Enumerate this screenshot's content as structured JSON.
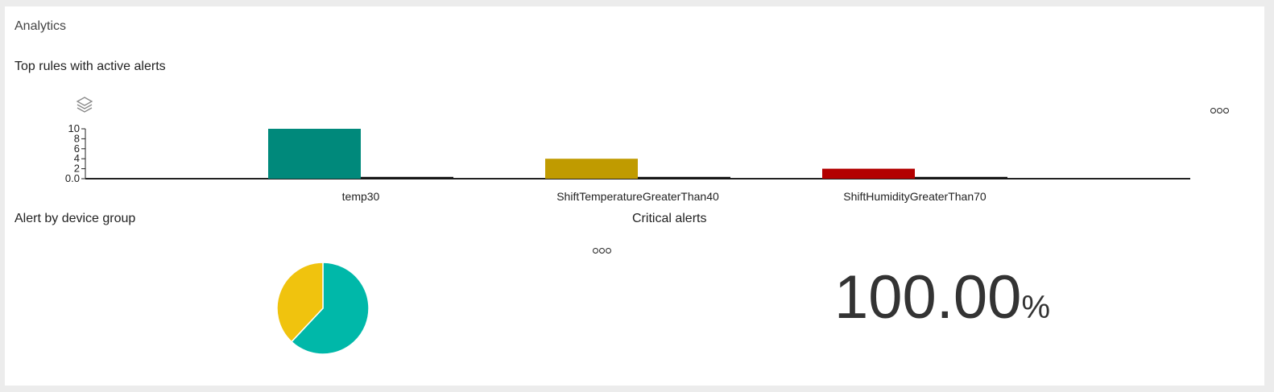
{
  "panel": {
    "title": "Analytics"
  },
  "top_rules": {
    "title": "Top rules with active alerts"
  },
  "device_group": {
    "title": "Alert by device group"
  },
  "critical": {
    "title": "Critical alerts",
    "value": "100.00",
    "unit": "%"
  },
  "icons": {
    "layers": "layers-icon",
    "more": "more-options-icon"
  },
  "colors": {
    "teal_bar": "#00897b",
    "olive_bar": "#c09b00",
    "red_bar": "#b30000",
    "pie_teal": "#00b8a9",
    "pie_yellow": "#f0c30e"
  },
  "chart_data": [
    {
      "type": "bar",
      "title": "Top rules with active alerts",
      "categories": [
        "temp30",
        "ShiftTemperatureGreaterThan40",
        "ShiftHumidityGreaterThan70"
      ],
      "series": [
        {
          "values": [
            10,
            4,
            2
          ],
          "colors": [
            "#00897b",
            "#c09b00",
            "#b30000"
          ]
        },
        {
          "values": [
            0.2,
            0.2,
            0.2
          ],
          "colors": [
            "#111111",
            "#111111",
            "#111111"
          ]
        }
      ],
      "yticks": [
        "0.0",
        "2",
        "4",
        "6",
        "8",
        "10"
      ],
      "ylim": [
        0,
        10
      ]
    },
    {
      "type": "pie",
      "title": "Alert by device group",
      "values": [
        62,
        38
      ],
      "colors": [
        "#00b8a9",
        "#f0c30e"
      ]
    }
  ]
}
